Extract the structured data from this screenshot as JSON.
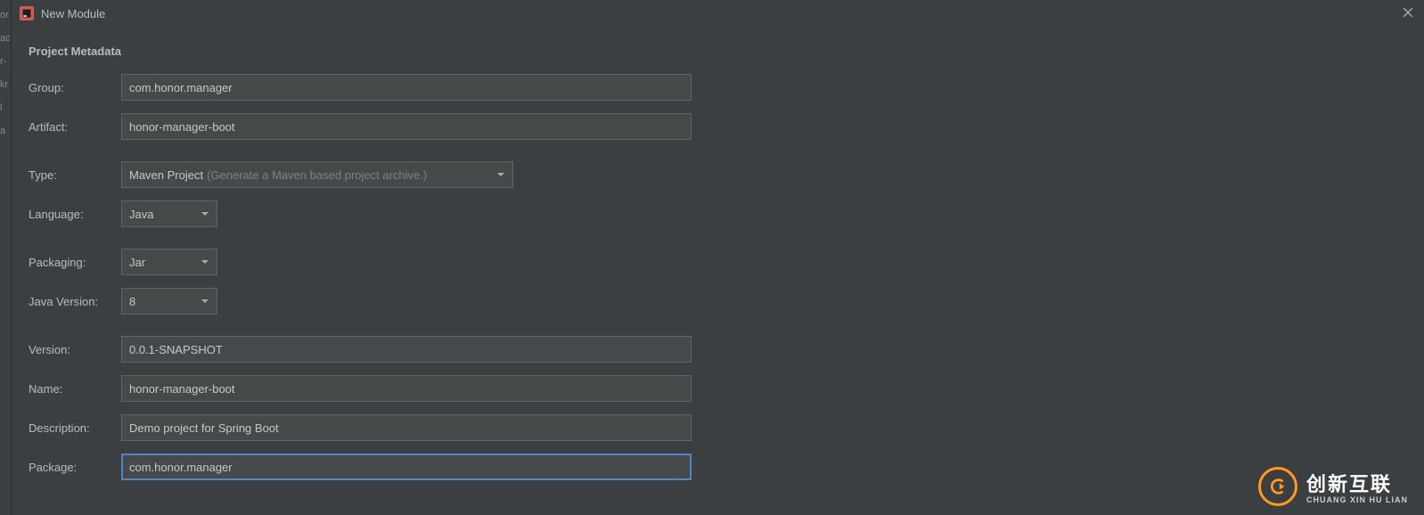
{
  "window": {
    "title": "New Module"
  },
  "section": {
    "title": "Project Metadata"
  },
  "labels": {
    "group": "Group:",
    "artifact": "Artifact:",
    "type": "Type:",
    "language": "Language:",
    "packaging": "Packaging:",
    "javaVersion": "Java Version:",
    "version": "Version:",
    "name": "Name:",
    "description": "Description:",
    "package": "Package:"
  },
  "values": {
    "group": "com.honor.manager",
    "artifact": "honor-manager-boot",
    "type": "Maven Project",
    "typeHint": "(Generate a Maven based project archive.)",
    "language": "Java",
    "packaging": "Jar",
    "javaVersion": "8",
    "version": "0.0.1-SNAPSHOT",
    "name": "honor-manager-boot",
    "description": "Demo project for Spring Boot",
    "package": "com.honor.manager"
  },
  "watermark": {
    "brand": "创新互联",
    "sub": "CHUANG XIN HU LIAN"
  },
  "leftStrip": [
    "or",
    "ac",
    "",
    "r-",
    "kr",
    "l",
    "",
    "a"
  ]
}
